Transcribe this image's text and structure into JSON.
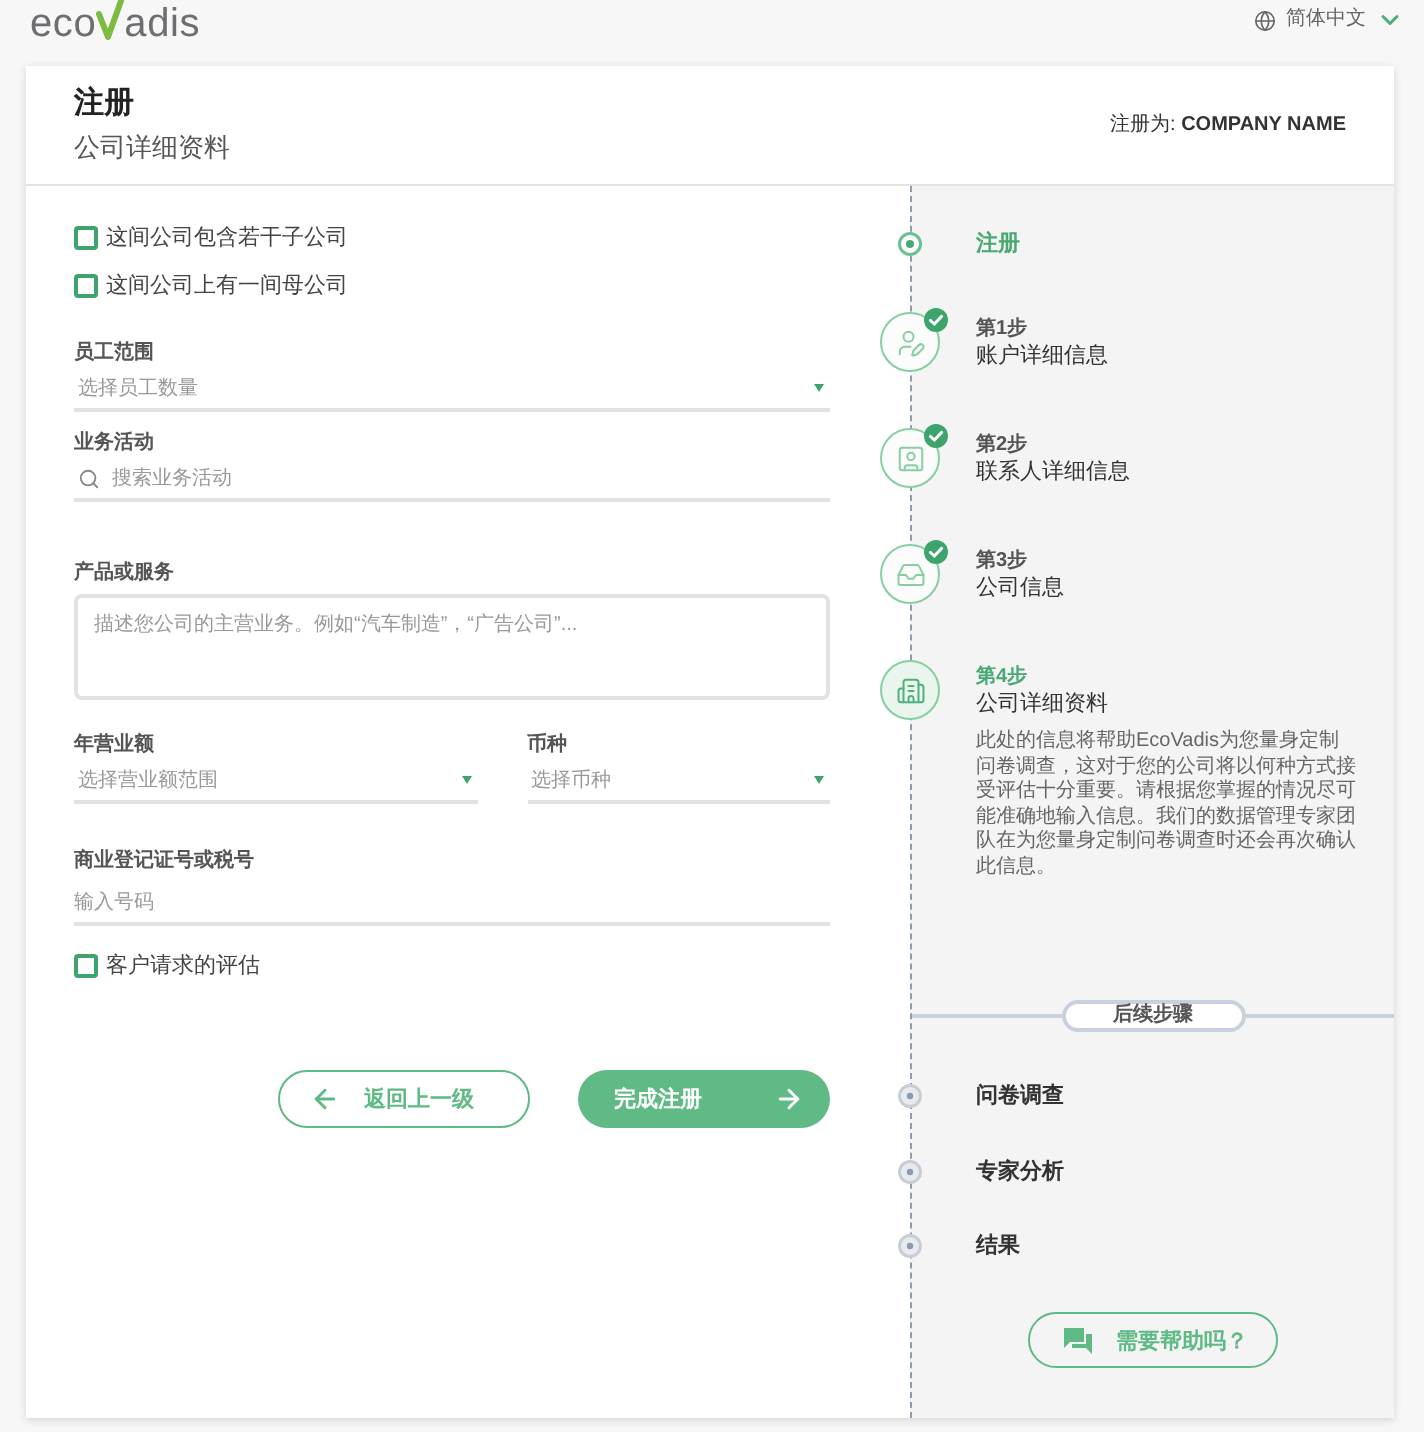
{
  "top_bar": {
    "logo": {
      "text_parts": [
        "eco",
        "adis"
      ]
    },
    "language": "简体中文"
  },
  "header": {
    "title": "注册",
    "subtitle": "公司详细资料",
    "registered_as": "注册为: **COMPANY NAME**"
  },
  "form": {
    "items": [
      {
        "kind": "checkbox",
        "label": "这间公司包含若干子公司",
        "checked": false
      },
      {
        "kind": "checkbox",
        "label": "这间公司上有一间母公司",
        "checked": false
      },
      {
        "kind": "select",
        "label": "员工范围",
        "placeholder": "选择员工数量"
      },
      {
        "kind": "search",
        "label": "业务活动",
        "placeholder": "搜索业务活动"
      },
      {
        "kind": "textarea",
        "label": "产品或服务",
        "placeholder": "描述您公司的主营业务。例如“汽车制造”，“广告公司”..."
      },
      {
        "kind": "row",
        "fields": [
          {
            "kind": "select",
            "label": "年营业额",
            "placeholder": "选择营业额范围"
          },
          {
            "kind": "select",
            "label": "币种",
            "placeholder": "选择币种"
          }
        ]
      },
      {
        "kind": "text",
        "label": "商业登记证号或税号",
        "placeholder": "输入号码"
      },
      {
        "kind": "checkbox",
        "label": "客户请求的评估",
        "checked": false
      }
    ],
    "buttons": [
      {
        "kind": "back",
        "label": "返回上一级"
      },
      {
        "kind": "submit",
        "label": "完成注册"
      }
    ]
  },
  "progress": {
    "start": {
      "label": "注册"
    },
    "steps": [
      {
        "number": "第1步",
        "title": "账户详细信息",
        "done": true,
        "selected": false
      },
      {
        "number": "第2步",
        "title": "联系人详细信息",
        "done": true,
        "selected": false
      },
      {
        "number": "第3步",
        "title": "公司信息",
        "done": true,
        "selected": false
      },
      {
        "number": "第4步",
        "title": "公司详细资料",
        "done": false,
        "selected": true,
        "description": "此处的信息将帮助EcoVadis为您量身定制问卷调查，这对于您的公司将以何种方式接受评估十分重要。请根据您掌握的情况尽可能准确地输入信息。我们的数据管理专家团队在为您量身定制问卷调查时还会再次确认此信息。"
      }
    ],
    "later": {
      "title": "后续步骤",
      "items": [
        "问卷调查",
        "专家分析",
        "结果"
      ]
    },
    "help_button": "需要帮助吗？"
  }
}
